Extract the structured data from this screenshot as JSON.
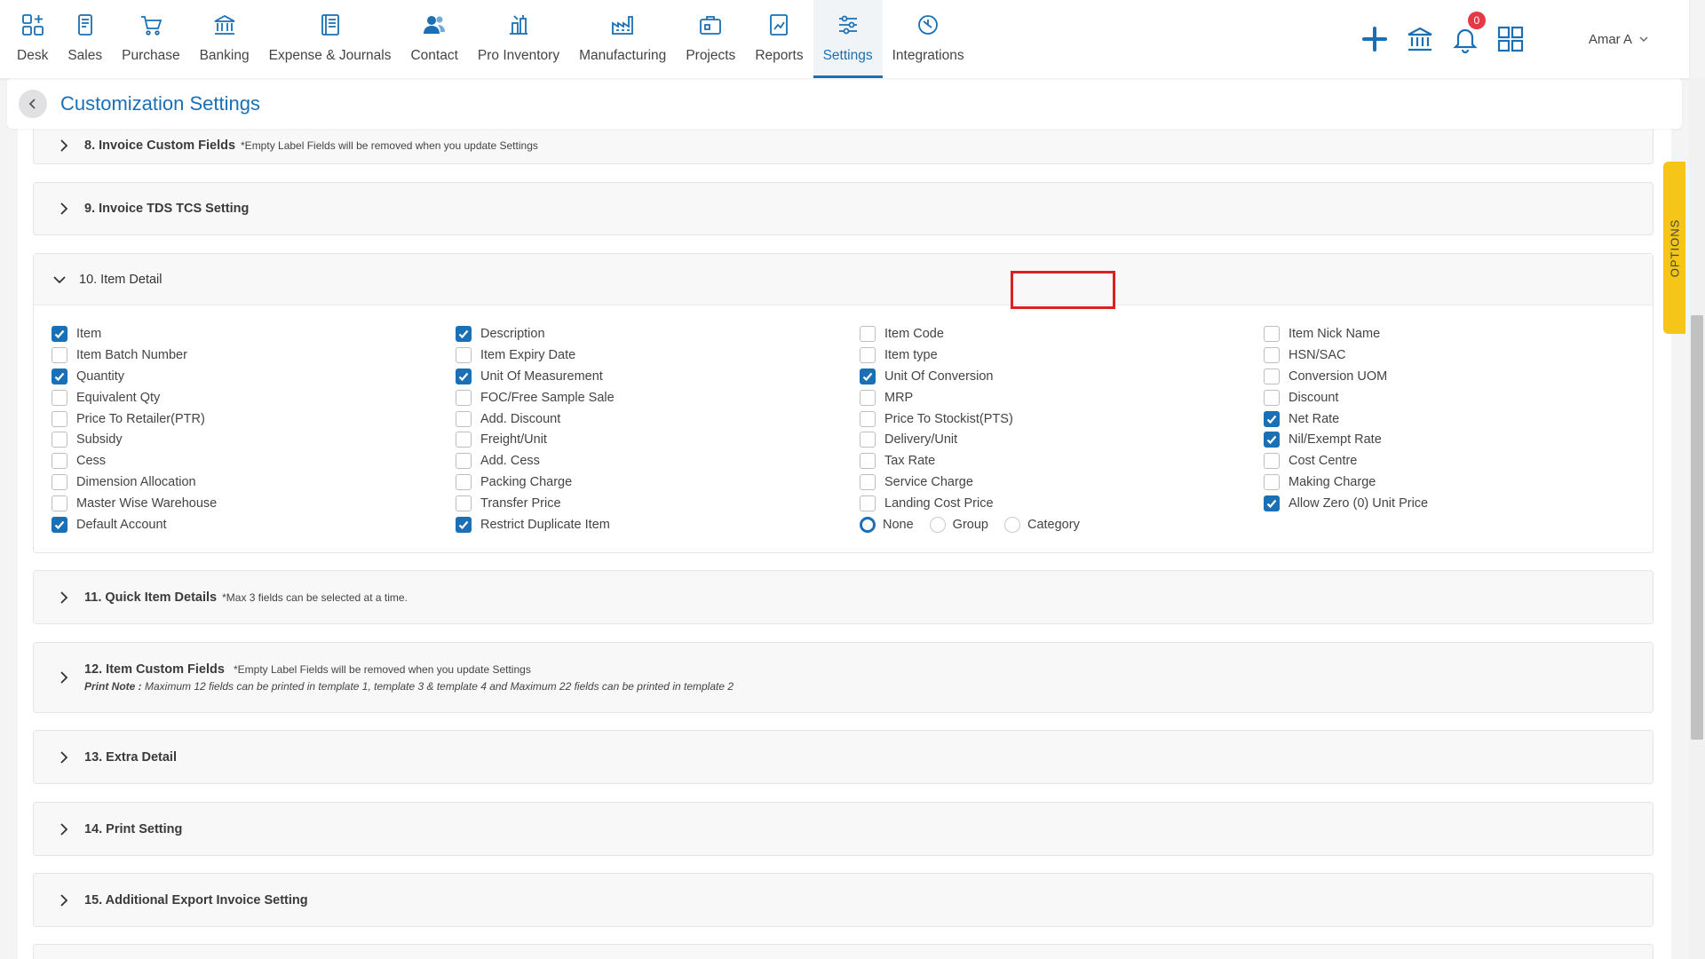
{
  "nav": {
    "items": [
      {
        "label": "Desk",
        "icon": "desk-icon"
      },
      {
        "label": "Sales",
        "icon": "sales-icon"
      },
      {
        "label": "Purchase",
        "icon": "cart-icon"
      },
      {
        "label": "Banking",
        "icon": "bank-icon"
      },
      {
        "label": "Expense & Journals",
        "icon": "journal-icon"
      },
      {
        "label": "Contact",
        "icon": "contacts-icon"
      },
      {
        "label": "Pro Inventory",
        "icon": "inventory-icon"
      },
      {
        "label": "Manufacturing",
        "icon": "factory-icon"
      },
      {
        "label": "Projects",
        "icon": "projects-icon"
      },
      {
        "label": "Reports",
        "icon": "reports-icon"
      },
      {
        "label": "Settings",
        "icon": "sliders-icon",
        "active": true
      },
      {
        "label": "Integrations",
        "icon": "integrations-icon"
      }
    ],
    "notification_count": "0",
    "user_name": "Amar A"
  },
  "header": {
    "title": "Customization Settings"
  },
  "sections": {
    "s8": {
      "title": "8. Invoice Custom Fields",
      "note": "*Empty Label Fields will be removed when you update Settings"
    },
    "s9": {
      "title": "9. Invoice TDS TCS Setting"
    },
    "s10": {
      "title": "10. Item Detail"
    },
    "s11": {
      "title": "11. Quick Item Details",
      "note": "*Max 3 fields can be selected at a time."
    },
    "s12": {
      "title": "12. Item Custom Fields",
      "note": "*Empty Label Fields will be removed when you update Settings",
      "print_note_label": "Print Note :",
      "print_note": " Maximum 12 fields can be printed in template 1, template 3 & template 4 and Maximum 22 fields can be printed in template 2"
    },
    "s13": {
      "title": "13. Extra Detail"
    },
    "s14": {
      "title": "14. Print Setting"
    },
    "s15": {
      "title": "15. Additional Export Invoice Setting"
    }
  },
  "item_detail": {
    "col1": [
      {
        "label": "Item",
        "checked": true
      },
      {
        "label": "Item Batch Number",
        "checked": false
      },
      {
        "label": "Quantity",
        "checked": true
      },
      {
        "label": "Equivalent Qty",
        "checked": false
      },
      {
        "label": "Price To Retailer(PTR)",
        "checked": false
      },
      {
        "label": "Subsidy",
        "checked": false
      },
      {
        "label": "Cess",
        "checked": false
      },
      {
        "label": "Dimension Allocation",
        "checked": false
      },
      {
        "label": "Master Wise Warehouse",
        "checked": false
      },
      {
        "label": "Default Account",
        "checked": true
      }
    ],
    "col2": [
      {
        "label": "Description",
        "checked": true
      },
      {
        "label": "Item Expiry Date",
        "checked": false
      },
      {
        "label": "Unit Of Measurement",
        "checked": true
      },
      {
        "label": "FOC/Free Sample Sale",
        "checked": false
      },
      {
        "label": "Add. Discount",
        "checked": false
      },
      {
        "label": "Freight/Unit",
        "checked": false
      },
      {
        "label": "Add. Cess",
        "checked": false
      },
      {
        "label": "Packing Charge",
        "checked": false
      },
      {
        "label": "Transfer Price",
        "checked": false
      },
      {
        "label": "Restrict Duplicate Item",
        "checked": true
      }
    ],
    "col3": [
      {
        "label": "Item Code",
        "checked": false
      },
      {
        "label": "Item type",
        "checked": false
      },
      {
        "label": "Unit Of Conversion",
        "checked": true
      },
      {
        "label": "MRP",
        "checked": false
      },
      {
        "label": "Price To Stockist(PTS)",
        "checked": false
      },
      {
        "label": "Delivery/Unit",
        "checked": false
      },
      {
        "label": "Tax Rate",
        "checked": false
      },
      {
        "label": "Service Charge",
        "checked": false
      },
      {
        "label": "Landing Cost Price",
        "checked": false
      }
    ],
    "col3_radios": [
      {
        "label": "None",
        "checked": true
      },
      {
        "label": "Group",
        "checked": false
      },
      {
        "label": "Category",
        "checked": false
      }
    ],
    "col4": [
      {
        "label": "Item Nick Name",
        "checked": false
      },
      {
        "label": "HSN/SAC",
        "checked": false
      },
      {
        "label": "Conversion UOM",
        "checked": false
      },
      {
        "label": "Discount",
        "checked": false
      },
      {
        "label": "Net Rate",
        "checked": true
      },
      {
        "label": "Nil/Exempt Rate",
        "checked": true
      },
      {
        "label": "Cost Centre",
        "checked": false
      },
      {
        "label": "Making Charge",
        "checked": false
      },
      {
        "label": "Allow Zero (0) Unit Price",
        "checked": true
      }
    ]
  },
  "options_tab": "OPTIONS",
  "colors": {
    "primary": "#1a6fb5",
    "highlight": "#dc1f26",
    "options": "#f5c518",
    "badge": "#e63946"
  }
}
